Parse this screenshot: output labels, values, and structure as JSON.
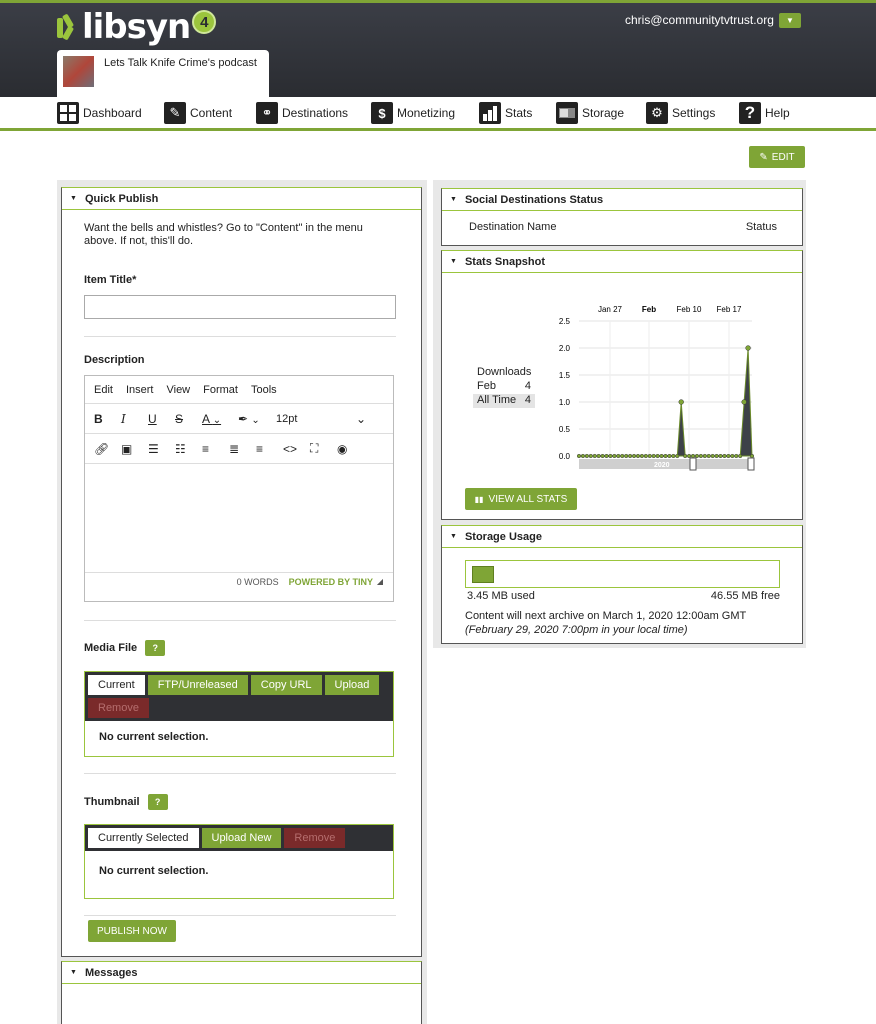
{
  "header": {
    "logo_text": "libsyn",
    "logo_badge": "4",
    "user_email": "chris@communitytvtrust.org",
    "podcast_name": "Lets Talk Knife Crime's podcast"
  },
  "nav": [
    {
      "label": "Dashboard",
      "icon": "dashboard-icon"
    },
    {
      "label": "Content",
      "icon": "content-icon"
    },
    {
      "label": "Destinations",
      "icon": "destinations-icon"
    },
    {
      "label": "Monetizing",
      "icon": "dollar-icon"
    },
    {
      "label": "Stats",
      "icon": "stats-icon"
    },
    {
      "label": "Storage",
      "icon": "storage-icon"
    },
    {
      "label": "Settings",
      "icon": "gear-icon"
    },
    {
      "label": "Help",
      "icon": "help-icon"
    }
  ],
  "edit_button": "EDIT",
  "quick_publish": {
    "title": "Quick Publish",
    "intro": "Want the bells and whistles? Go to \"Content\" in the menu above. If not, this'll do.",
    "item_title_label": "Item Title*",
    "description_label": "Description",
    "editor_menu": [
      "Edit",
      "Insert",
      "View",
      "Format",
      "Tools"
    ],
    "font_size": "12pt",
    "word_count": "0 WORDS",
    "powered_by": "POWERED BY TINY",
    "media_label": "Media File",
    "media_tabs": [
      "Current",
      "FTP/Unreleased",
      "Copy URL",
      "Upload",
      "Remove"
    ],
    "media_empty": "No current selection.",
    "thumb_label": "Thumbnail",
    "thumb_tabs": [
      "Currently Selected",
      "Upload New",
      "Remove"
    ],
    "thumb_empty": "No current selection.",
    "help_mark": "?",
    "publish_button": "PUBLISH NOW"
  },
  "messages": {
    "title": "Messages"
  },
  "social": {
    "title": "Social Destinations Status",
    "col_name": "Destination Name",
    "col_status": "Status"
  },
  "stats": {
    "title": "Stats Snapshot",
    "downloads_label": "Downloads",
    "rows": [
      {
        "label": "Feb",
        "value": "4"
      },
      {
        "label": "All Time",
        "value": "4"
      }
    ],
    "view_all": "VIEW ALL STATS"
  },
  "chart_data": {
    "type": "area",
    "y_ticks": [
      "2.5",
      "2.0",
      "1.5",
      "1.0",
      "0.5",
      "0.0"
    ],
    "ylim": [
      0,
      2.5
    ],
    "x_labels": [
      "Jan 27",
      "Feb",
      "Feb 10",
      "Feb 17"
    ],
    "navigator_label": "2020",
    "values": [
      0,
      0,
      0,
      0,
      0,
      0,
      0,
      0,
      0,
      0,
      0,
      0,
      0,
      0,
      0,
      0,
      0,
      0,
      0,
      0,
      0,
      0,
      0,
      0,
      0,
      0,
      1,
      0,
      0,
      0,
      0,
      0,
      0,
      0,
      0,
      0,
      0,
      0,
      0,
      0,
      0,
      0,
      1,
      2,
      0
    ]
  },
  "storage": {
    "title": "Storage Usage",
    "used": "3.45 MB used",
    "free": "46.55 MB free",
    "used_fraction": 0.069,
    "note": "Content will next archive on March 1, 2020 12:00am GMT",
    "note_local": "(February 29, 2020 7:00pm in your local time)"
  },
  "colors": {
    "accent": "#7fa536",
    "header": "#2f3136",
    "danger": "#7a2a2a"
  }
}
